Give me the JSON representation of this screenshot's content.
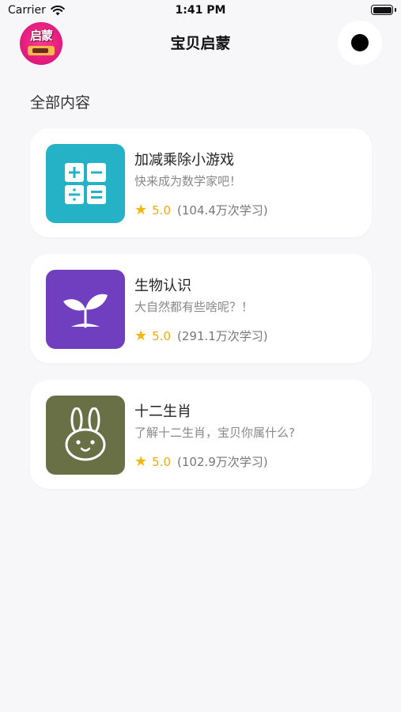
{
  "status_bar": {
    "carrier": "Carrier",
    "time": "1:41 PM"
  },
  "nav": {
    "logo_text": "启蒙",
    "title": "宝贝启蒙"
  },
  "section": {
    "title": "全部内容"
  },
  "cards": [
    {
      "title": "加减乘除小游戏",
      "subtitle": "快来成为数学家吧！",
      "rating": "5.0",
      "count": "(104.4万次学习)",
      "icon": "math-operators-icon",
      "color": "#26b2c6"
    },
    {
      "title": "生物认识",
      "subtitle": "大自然都有些啥呢？！",
      "rating": "5.0",
      "count": "(291.1万次学习)",
      "icon": "sprout-icon",
      "color": "#6f3fc0"
    },
    {
      "title": "十二生肖",
      "subtitle": "了解十二生肖，宝贝你属什么?",
      "rating": "5.0",
      "count": "(102.9万次学习)",
      "icon": "rabbit-icon",
      "color": "#6a7046"
    }
  ],
  "colors": {
    "background": "#f7f7fa",
    "rating": "#f5b50a"
  }
}
